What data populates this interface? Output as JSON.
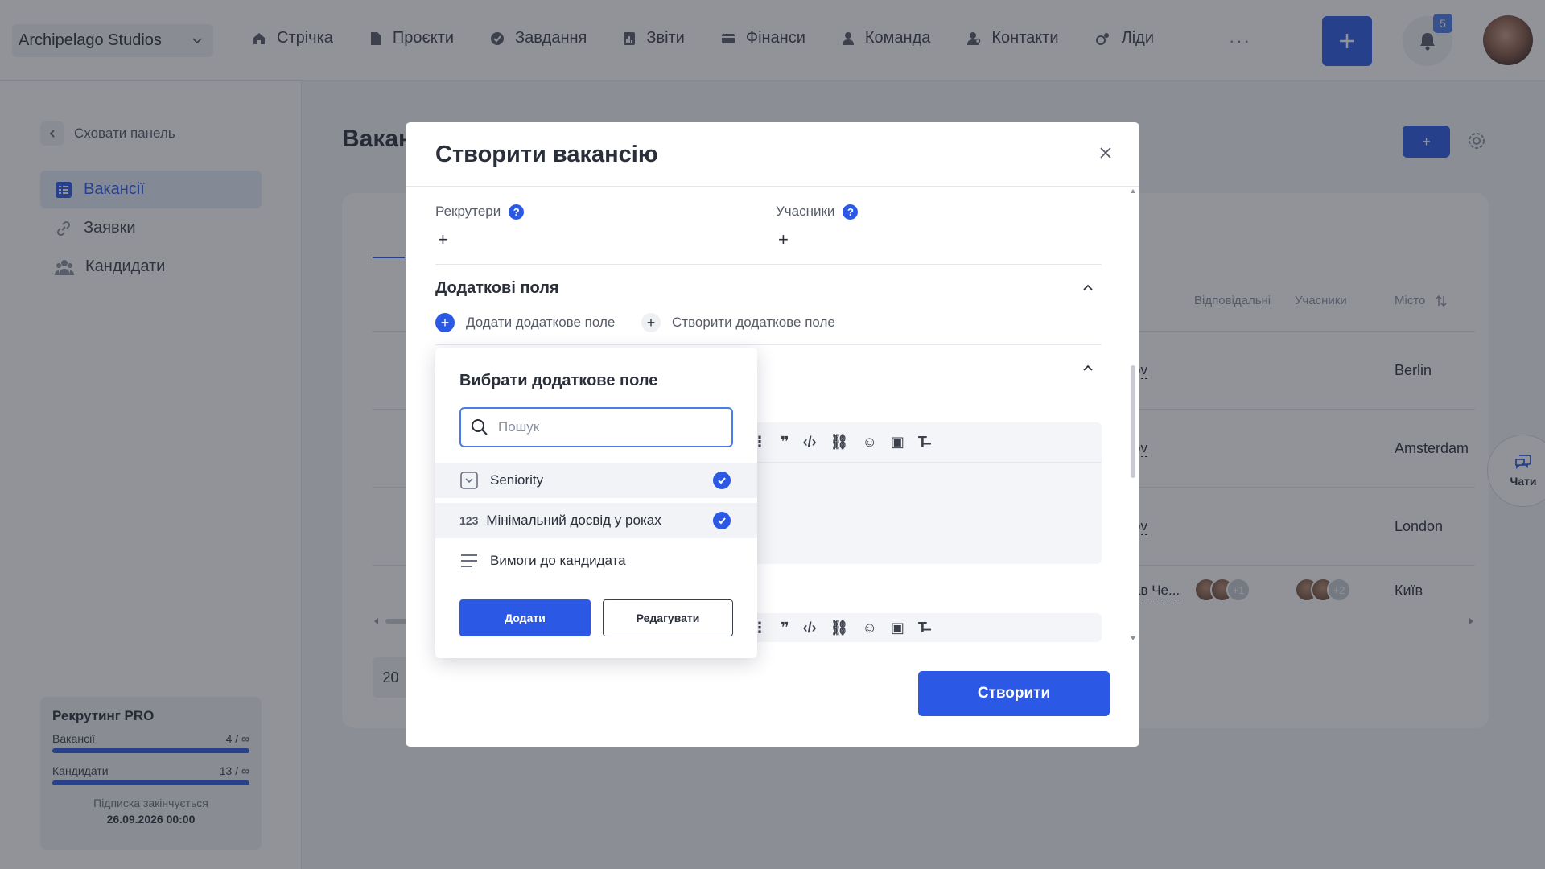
{
  "company": {
    "name": "Archipelago Studios"
  },
  "nav": {
    "items": [
      {
        "label": "Стрічка",
        "icon": "home-icon"
      },
      {
        "label": "Проєкти",
        "icon": "document-icon"
      },
      {
        "label": "Завдання",
        "icon": "check-circle-icon"
      },
      {
        "label": "Звіти",
        "icon": "report-icon"
      },
      {
        "label": "Фінанси",
        "icon": "wallet-icon"
      },
      {
        "label": "Команда",
        "icon": "user-icon"
      },
      {
        "label": "Контакти",
        "icon": "contacts-icon"
      },
      {
        "label": "Ліди",
        "icon": "leads-icon"
      }
    ],
    "more": "···",
    "notifications_count": "5"
  },
  "sidebar": {
    "hide_label": "Сховати панель",
    "items": [
      {
        "label": "Вакансії",
        "icon": "list-icon",
        "active": true
      },
      {
        "label": "Заявки",
        "icon": "link-icon"
      },
      {
        "label": "Кандидати",
        "icon": "people-icon"
      }
    ],
    "plan": {
      "title": "Рекрутинг PRO",
      "vacancies_label": "Вакансії",
      "vacancies_value": "4 / ∞",
      "candidates_label": "Кандидати",
      "candidates_value": "13 / ∞",
      "expires_label": "Підписка закінчується",
      "expires_date": "26.09.2026 00:00"
    }
  },
  "main": {
    "title": "Вакан",
    "add_label": "+",
    "columns": {
      "responsible": "Відповідальні",
      "members": "Учасники",
      "city": "Місто"
    },
    "rows": [
      {
        "person": "ov",
        "city": "Berlin"
      },
      {
        "person": "ov",
        "city": "Amsterdam"
      },
      {
        "person": "ov",
        "city": "London"
      },
      {
        "person": "ав Че...",
        "city": "Київ",
        "resp_more": "+1",
        "members_more": "+2"
      }
    ],
    "page_size": "20"
  },
  "chat": {
    "label": "Чати"
  },
  "modal": {
    "title": "Створити вакансію",
    "recruiters_label": "Рекрутери",
    "members_label": "Учасники",
    "help": "?",
    "plus": "+",
    "extra_fields_title": "Додаткові поля",
    "add_extra_label": "Додати додаткове поле",
    "create_extra_label": "Створити додаткове поле",
    "create_button": "Створити"
  },
  "dropdown": {
    "title": "Вибрати додаткове поле",
    "search_placeholder": "Пошук",
    "items": [
      {
        "label": "Seniority",
        "icon": "select-icon",
        "checked": true
      },
      {
        "label": "Мінімальний досвід у роках",
        "icon": "number-icon",
        "icon_text": "123",
        "checked": true
      },
      {
        "label": "Вимоги до кандидата",
        "icon": "text-lines-icon",
        "checked": false
      }
    ],
    "add_button": "Додати",
    "edit_button": "Редагувати"
  },
  "colors": {
    "accent": "#2b59e6",
    "overlay": "rgba(35,40,50,0.5)"
  }
}
